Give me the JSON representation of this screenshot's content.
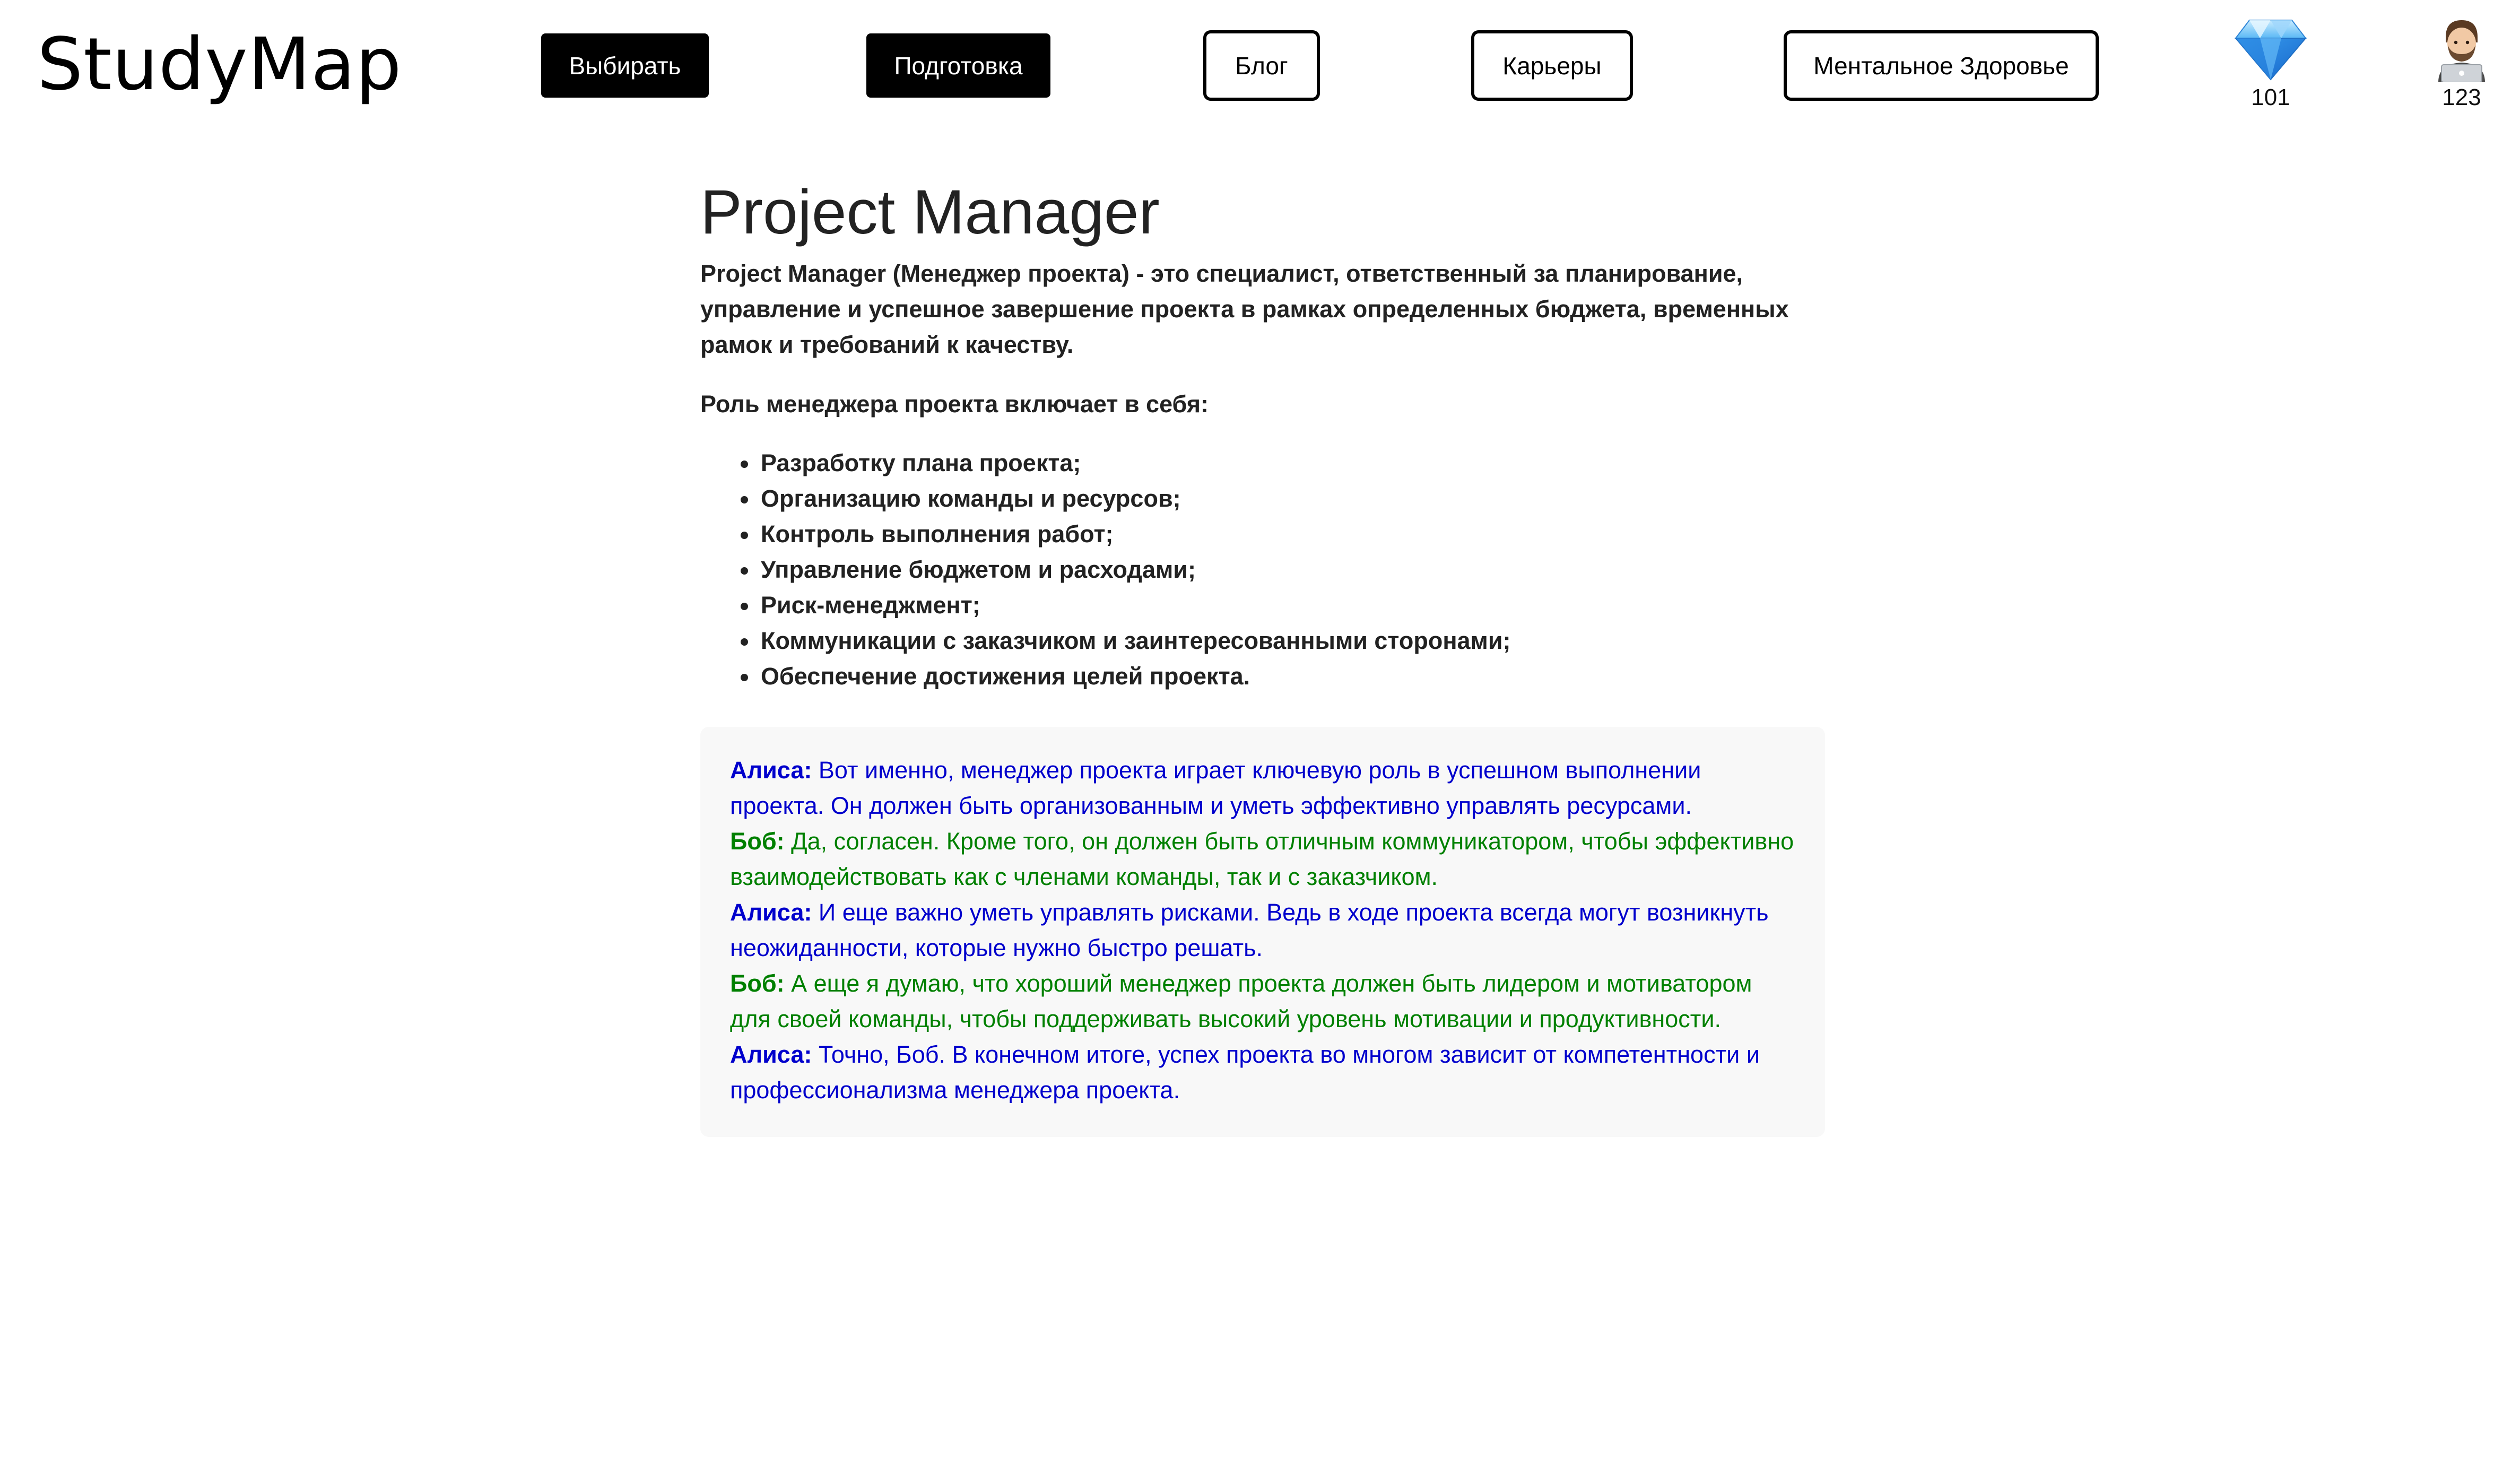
{
  "header": {
    "logo": "StudyMap",
    "nav": [
      {
        "label": "Выбирать"
      },
      {
        "label": "Подготовка"
      },
      {
        "label": "Блог"
      },
      {
        "label": "Карьеры"
      },
      {
        "label": "Ментальное Здоровье"
      }
    ],
    "gems": {
      "icon": "diamond-icon",
      "count": "101"
    },
    "profile": {
      "icon": "avatar-icon",
      "count": "123"
    }
  },
  "main": {
    "title": "Project Manager",
    "intro": "Project Manager (Менеджер проекта) - это специалист, ответственный за планирование, управление и успешное завершение проекта в рамках определенных бюджета, временных рамок и требований к качеству.",
    "role_heading": "Роль менеджера проекта включает в себя:",
    "duties": [
      "Разработку плана проекта;",
      "Организацию команды и ресурсов;",
      "Контроль выполнения работ;",
      "Управление бюджетом и расходами;",
      "Риск-менеджмент;",
      "Коммуникации с заказчиком и заинтересованными сторонами;",
      "Обеспечение достижения целей проекта."
    ],
    "dialog": [
      {
        "speaker": "Алиса:",
        "text": " Вот именно, менеджер проекта играет ключевую роль в успешном выполнении проекта. Он должен быть организованным и уметь эффективно управлять ресурсами."
      },
      {
        "speaker": "Боб:",
        "text": " Да, согласен. Кроме того, он должен быть отличным коммуникатором, чтобы эффективно взаимодействовать как с членами команды, так и с заказчиком."
      },
      {
        "speaker": "Алиса:",
        "text": " И еще важно уметь управлять рисками. Ведь в ходе проекта всегда могут возникнуть неожиданности, которые нужно быстро решать."
      },
      {
        "speaker": "Боб:",
        "text": " А еще я думаю, что хороший менеджер проекта должен быть лидером и мотиватором для своей команды, чтобы поддерживать высокий уровень мотивации и продуктивности."
      },
      {
        "speaker": "Алиса:",
        "text": " Точно, Боб. В конечном итоге, успех проекта во многом зависит от компетентности и профессионализма менеджера проекта."
      }
    ]
  },
  "colors": {
    "alice": "#0000cc",
    "bob": "#008000",
    "dialog_bg": "#f8f8f8",
    "primary": "#000000"
  }
}
